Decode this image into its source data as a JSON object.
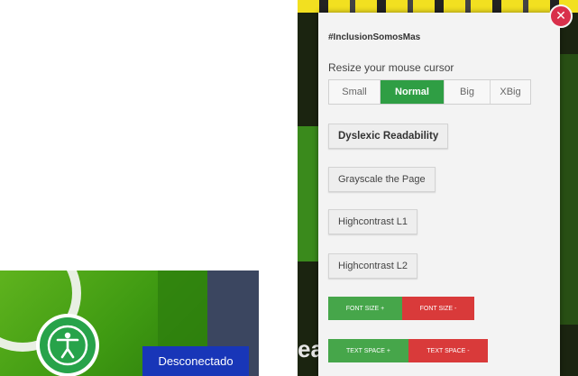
{
  "status": {
    "label": "Desconectado"
  },
  "icons": {
    "accessibility": "accessibility-person-icon",
    "close": "close-x-icon"
  },
  "colors": {
    "panel_green": "#2f9e44",
    "panel_red": "#d93a3a",
    "status_blue": "#1836b8",
    "close_red": "#d9304b"
  },
  "panel": {
    "hashtag": "#InclusionSomosMas",
    "resize_label": "Resize your mouse cursor",
    "cursor_sizes": [
      {
        "label": "Small",
        "active": false
      },
      {
        "label": "Normal",
        "active": true
      },
      {
        "label": "Big",
        "active": false
      },
      {
        "label": "XBig",
        "active": false
      }
    ],
    "dyslexic": "Dyslexic Readability",
    "grayscale": "Grayscale the Page",
    "highcontrast1": "Highcontrast L1",
    "highcontrast2": "Highcontrast L2",
    "fontsize_plus": "FONT SIZE +",
    "fontsize_minus": "FONT SIZE -",
    "textspace_plus": "TEXT SPACE +",
    "textspace_minus": "TEXT SPACE -"
  },
  "backdrop": {
    "partial_text": "ea"
  }
}
